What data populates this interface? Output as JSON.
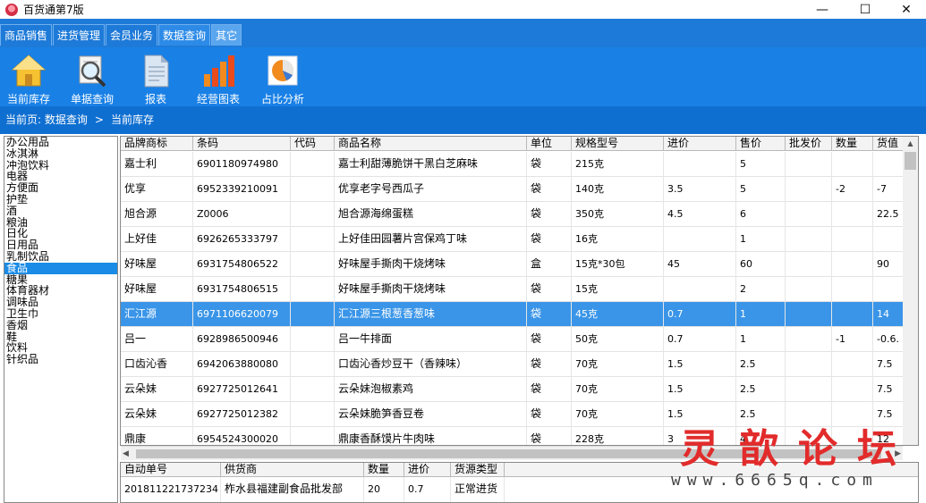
{
  "window": {
    "title": "百货通第7版",
    "min": "—",
    "max": "☐",
    "close": "✕"
  },
  "tabs": [
    {
      "label": "商品销售"
    },
    {
      "label": "进货管理"
    },
    {
      "label": "会员业务"
    },
    {
      "label": "数据查询"
    },
    {
      "label": "其它"
    }
  ],
  "toolbar": [
    {
      "label": "当前库存",
      "icon": "house-icon"
    },
    {
      "label": "单据查询",
      "icon": "magnifier-icon"
    },
    {
      "label": "报表",
      "icon": "report-icon"
    },
    {
      "label": "经营图表",
      "icon": "bar-chart-icon"
    },
    {
      "label": "占比分析",
      "icon": "pie-chart-icon"
    }
  ],
  "breadcrumb": {
    "label": "当前页: ",
    "section": "数据查询",
    "sep": ">",
    "page": "当前库存"
  },
  "categories": [
    "办公用品",
    "冰淇淋",
    "冲泡饮料",
    "电器",
    "方便面",
    "护垫",
    "酒",
    "粮油",
    "日化",
    "日用品",
    "乳制饮品",
    "食品",
    "糖果",
    "体育器材",
    "调味品",
    "卫生巾",
    "香烟",
    "鞋",
    "饮料",
    "针织品"
  ],
  "selected_category": "食品",
  "grid": {
    "columns": [
      "品牌商标",
      "条码",
      "代码",
      "商品名称",
      "单位",
      "规格型号",
      "进价",
      "售价",
      "批发价",
      "数量",
      "货值"
    ],
    "rows": [
      [
        "嘉士利",
        "6901180974980",
        "",
        "嘉士利甜薄脆饼干黑白芝麻味",
        "袋",
        "215克",
        "",
        "5",
        "",
        "",
        ""
      ],
      [
        "优享",
        "6952339210091",
        "",
        "优享老字号西瓜子",
        "袋",
        "140克",
        "3.5",
        "5",
        "",
        "-2",
        "-7"
      ],
      [
        "旭合源",
        "Z0006",
        "",
        "旭合源海绵蛋糕",
        "袋",
        "350克",
        "4.5",
        "6",
        "",
        "",
        "22.5"
      ],
      [
        "上好佳",
        "6926265333797",
        "",
        "上好佳田园薯片宫保鸡丁味",
        "袋",
        "16克",
        "",
        "1",
        "",
        "",
        ""
      ],
      [
        "好味屋",
        "6931754806522",
        "",
        "好味屋手撕肉干烧烤味",
        "盒",
        "15克*30包",
        "45",
        "60",
        "",
        "",
        "90"
      ],
      [
        "好味屋",
        "6931754806515",
        "",
        "好味屋手撕肉干烧烤味",
        "袋",
        "15克",
        "",
        "2",
        "",
        "",
        ""
      ],
      [
        "汇江源",
        "6971106620079",
        "",
        "汇江源三根葱香葱味",
        "袋",
        "45克",
        "0.7",
        "1",
        "",
        "",
        "14"
      ],
      [
        "吕一",
        "6928986500946",
        "",
        "吕一牛排面",
        "袋",
        "50克",
        "0.7",
        "1",
        "",
        "-1",
        "-0.6."
      ],
      [
        "口齿沁香",
        "6942063880080",
        "",
        "口齿沁香炒豆干（香辣味）",
        "袋",
        "70克",
        "1.5",
        "2.5",
        "",
        "",
        "7.5"
      ],
      [
        "云朵妹",
        "6927725012641",
        "",
        "云朵妹泡椒素鸡",
        "袋",
        "70克",
        "1.5",
        "2.5",
        "",
        "",
        "7.5"
      ],
      [
        "云朵妹",
        "6927725012382",
        "",
        "云朵妹脆笋香豆卷",
        "袋",
        "70克",
        "1.5",
        "2.5",
        "",
        "",
        "7.5"
      ],
      [
        "鼎康",
        "6954524300020",
        "",
        "鼎康香酥馍片牛肉味",
        "袋",
        "228克",
        "3",
        "4",
        "",
        "",
        "12"
      ]
    ],
    "selected_row": 6
  },
  "detail": {
    "columns": [
      "自动单号",
      "供货商",
      "数量",
      "进价",
      "货源类型"
    ],
    "row": [
      "201811221737234",
      "柞水县福建副食品批发部",
      "20",
      "0.7",
      "正常进货"
    ]
  },
  "watermark": {
    "title": "灵歆论坛",
    "url": "www.6665q.com"
  }
}
